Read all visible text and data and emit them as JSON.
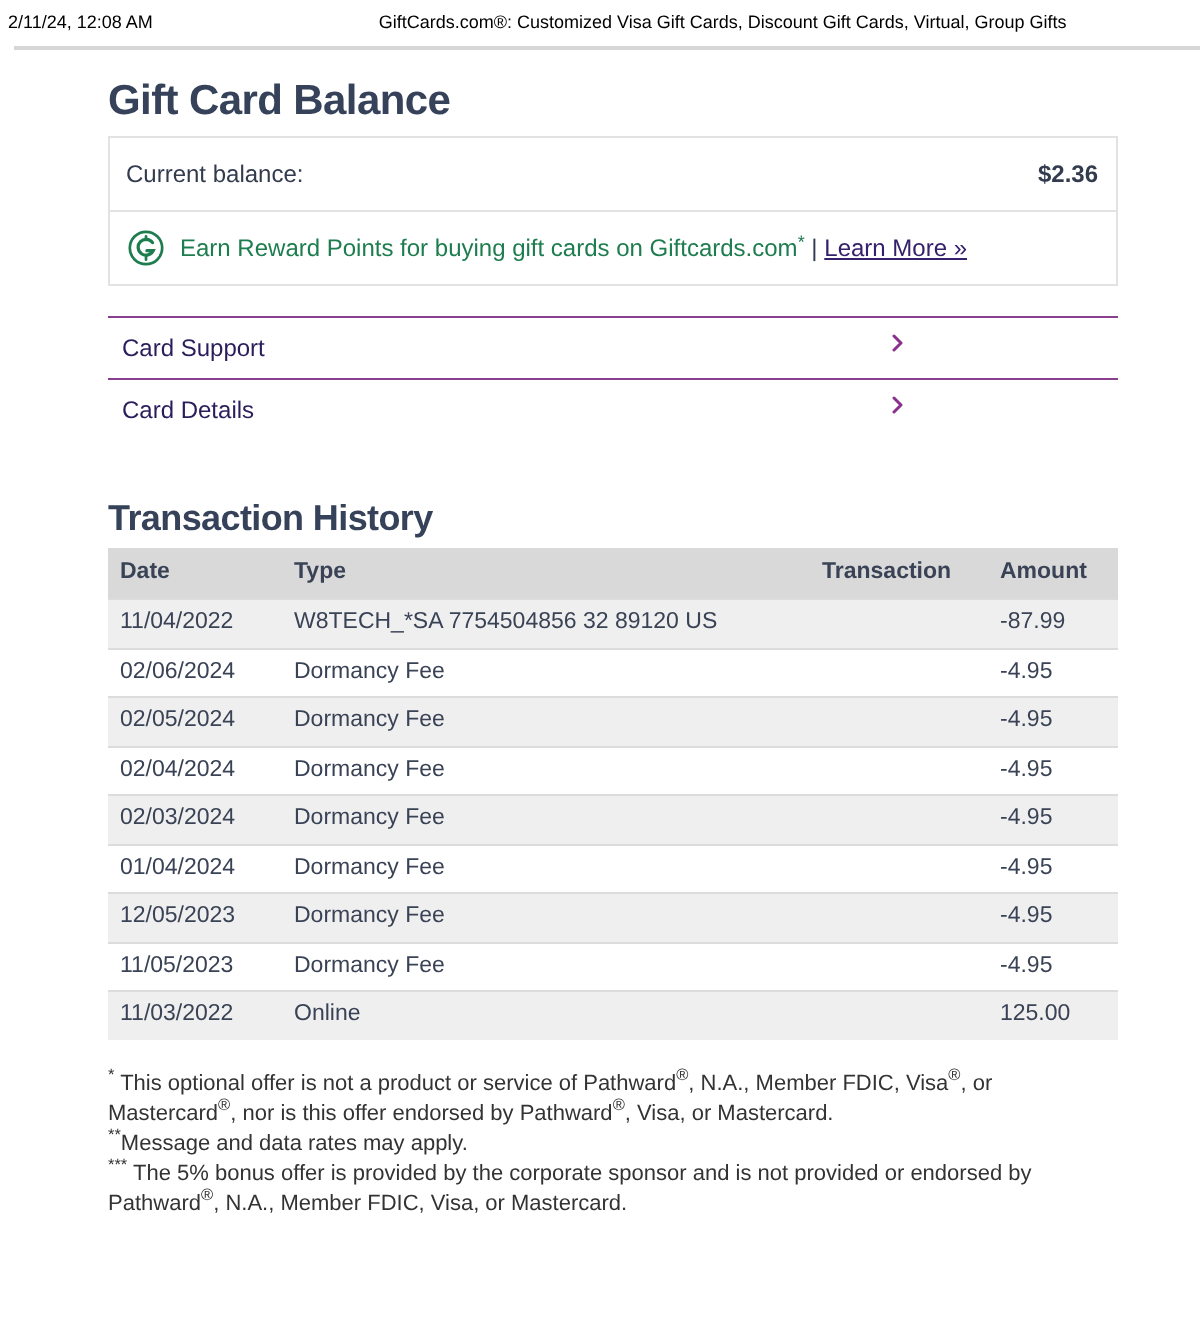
{
  "print_header": {
    "date": "2/11/24, 12:08 AM",
    "title": "GiftCards.com®: Customized Visa Gift Cards, Discount Gift Cards, Virtual, Group Gifts"
  },
  "page_title": "Gift Card Balance",
  "balance": {
    "label": "Current balance:",
    "value": "$2.36"
  },
  "reward": {
    "text": "Earn Reward Points for buying gift cards on Giftcards.com$^{*}$",
    "separator": "|",
    "link": "Learn More »"
  },
  "links": [
    "Card Support",
    "Card Details"
  ],
  "transactions": {
    "title": "Transaction History",
    "columns": [
      "Date",
      "Type",
      "Transaction",
      "Amount"
    ],
    "rows": [
      {
        "date": "11/04/2022",
        "type": "W8TECH_*SA 7754504856 32 89120 US",
        "amount": "-87.99"
      },
      {
        "date": "02/06/2024",
        "type": "Dormancy Fee",
        "amount": "-4.95"
      },
      {
        "date": "02/05/2024",
        "type": "Dormancy Fee",
        "amount": "-4.95"
      },
      {
        "date": "02/04/2024",
        "type": "Dormancy Fee",
        "amount": "-4.95"
      },
      {
        "date": "02/03/2024",
        "type": "Dormancy Fee",
        "amount": "-4.95"
      },
      {
        "date": "01/04/2024",
        "type": "Dormancy Fee",
        "amount": "-4.95"
      },
      {
        "date": "12/05/2023",
        "type": "Dormancy Fee",
        "amount": "-4.95"
      },
      {
        "date": "11/05/2023",
        "type": "Dormancy Fee",
        "amount": "-4.95"
      },
      {
        "date": "11/03/2022",
        "type": "Online",
        "amount": "125.00"
      }
    ]
  },
  "footnotes": [
    "$^{*}$ This optional offer is not a product or service of Pathward$^{®}$, N.A., Member FDIC, Visa$^{®}$, or Mastercard$^{®}$, nor is this offer endorsed by Pathward$^{®}$, Visa, or Mastercard.",
    "$^{**}$Message and data rates may apply.",
    "$^{***}$ The 5% bonus offer is provided by the corporate sponsor and is not provided or endorsed by Pathward$^{®}$, N.A., Member FDIC, Visa, or Mastercard."
  ]
}
